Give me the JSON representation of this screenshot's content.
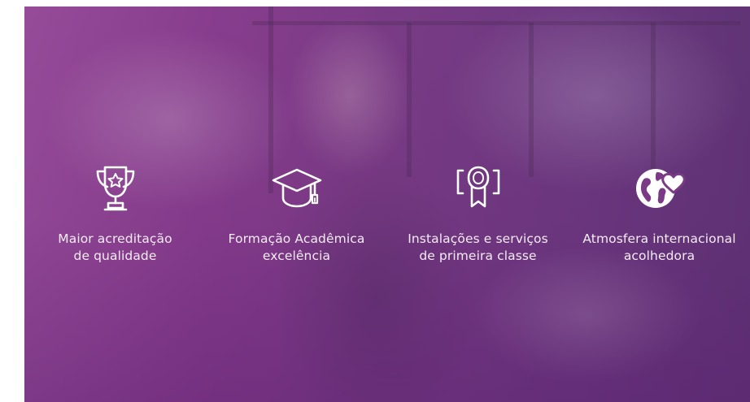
{
  "features": [
    {
      "icon": "trophy-star-icon",
      "line1": "Maior acreditação",
      "line2": "de qualidade"
    },
    {
      "icon": "graduation-cap-icon",
      "line1": "Formação Acadêmica",
      "line2": "excelência"
    },
    {
      "icon": "award-ribbon-icon",
      "line1": "Instalações e serviços",
      "line2": "de primeira classe"
    },
    {
      "icon": "globe-heart-icon",
      "line1": "Atmosfera internacional",
      "line2": "acolhedora"
    }
  ],
  "colors": {
    "overlay": "#8a3f8f",
    "text": "#ffffff"
  }
}
